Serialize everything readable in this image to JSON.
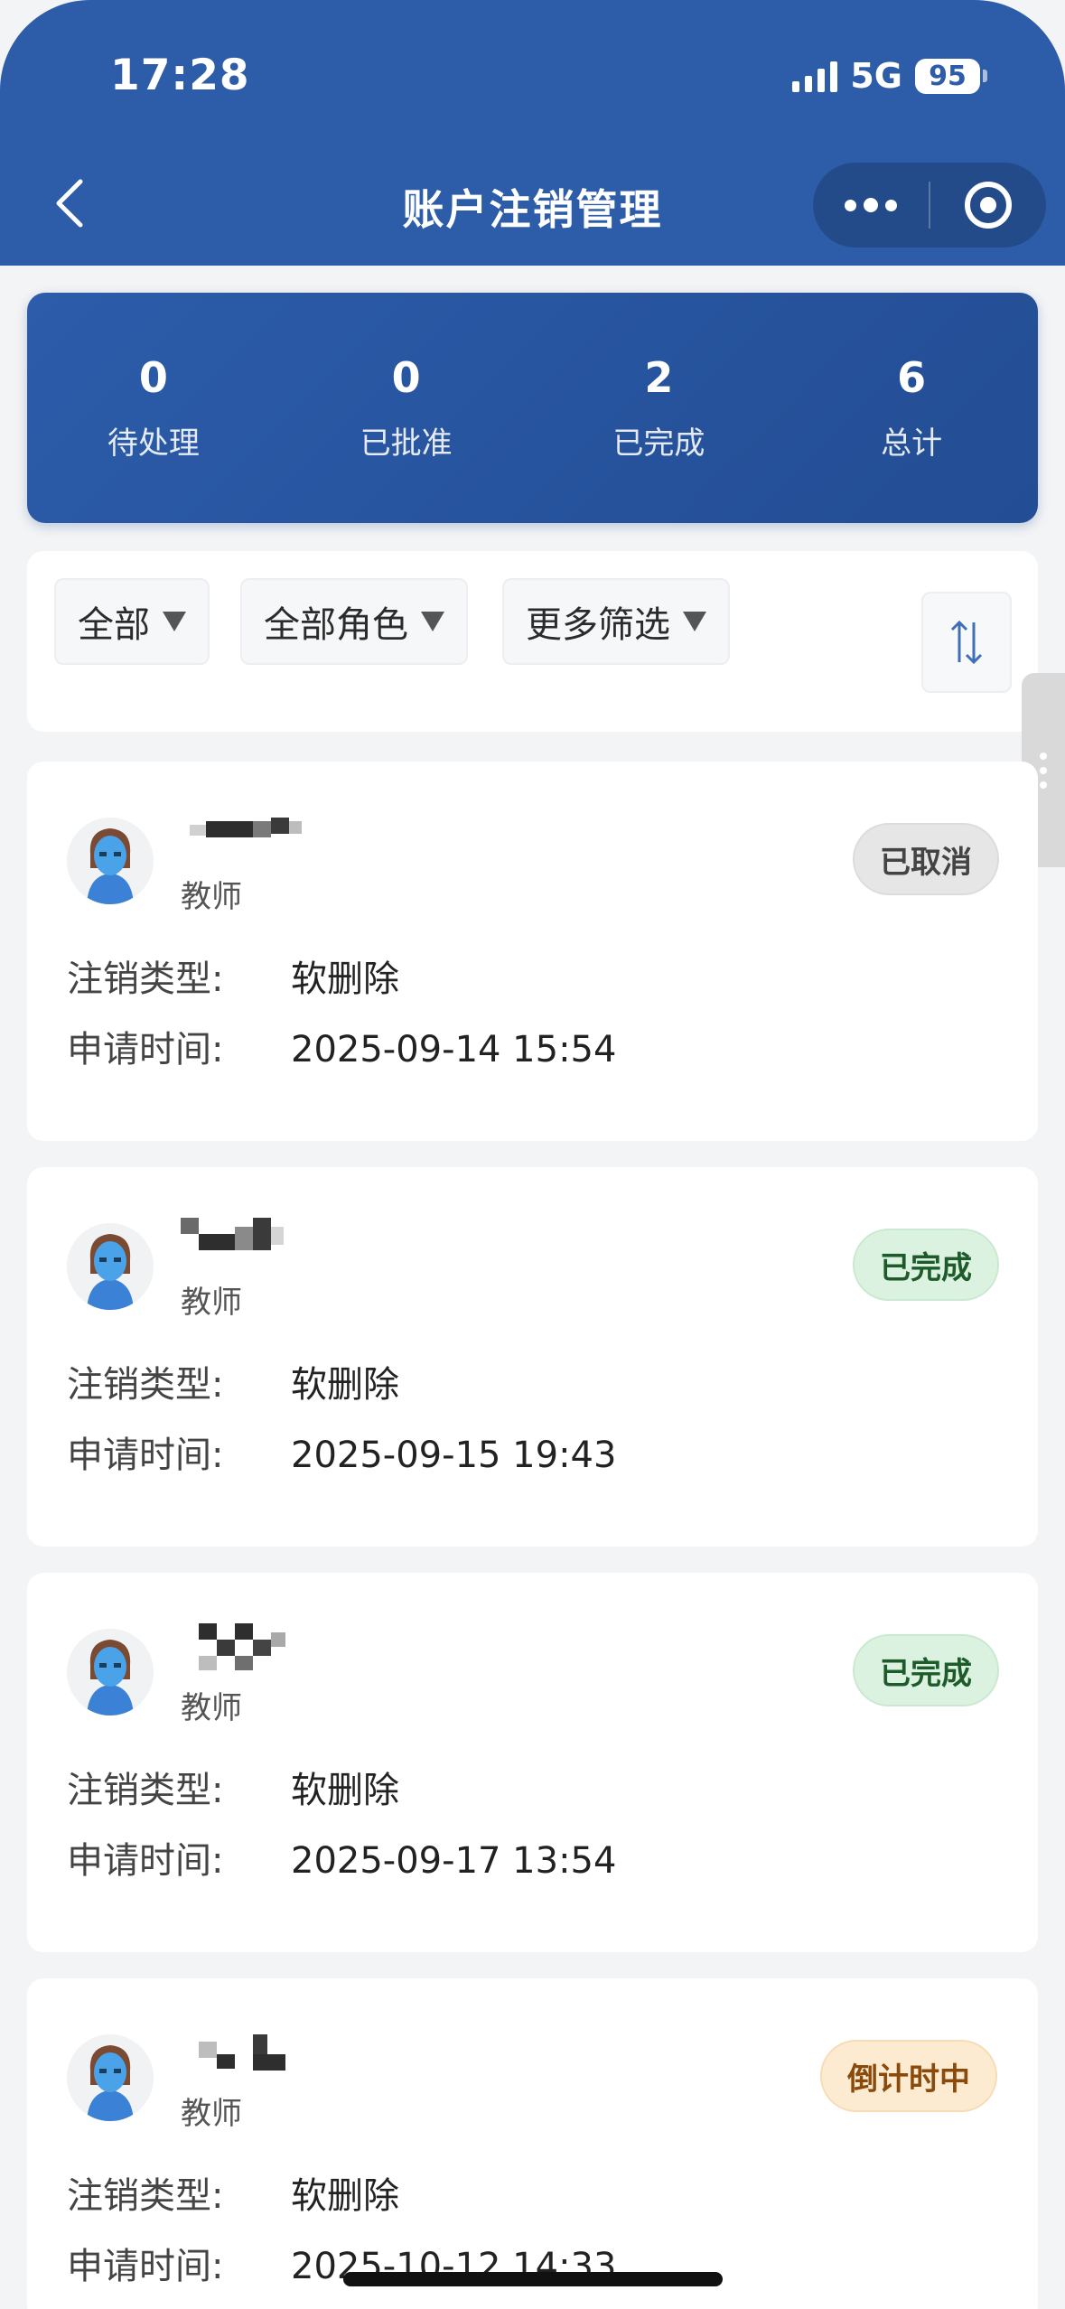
{
  "status_bar": {
    "time": "17:28",
    "network": "5G",
    "battery": "95"
  },
  "nav": {
    "title": "账户注销管理"
  },
  "stats": [
    {
      "value": "0",
      "label": "待处理"
    },
    {
      "value": "0",
      "label": "已批准"
    },
    {
      "value": "2",
      "label": "已完成"
    },
    {
      "value": "6",
      "label": "总计"
    }
  ],
  "filters": {
    "status": "全部",
    "role": "全部角色",
    "more": "更多筛选"
  },
  "labels": {
    "type": "注销类型:",
    "time": "申请时间:"
  },
  "records": [
    {
      "role": "教师",
      "status": "已取消",
      "type": "软删除",
      "time": "2025-09-14 15:54"
    },
    {
      "role": "教师",
      "status": "已完成",
      "type": "软删除",
      "time": "2025-09-15 19:43"
    },
    {
      "role": "教师",
      "status": "已完成",
      "type": "软删除",
      "time": "2025-09-17 13:54"
    },
    {
      "role": "教师",
      "status": "倒计时中",
      "type": "软删除",
      "time": "2025-10-12 14:33"
    }
  ],
  "colors": {
    "header": "#2d5ca8",
    "badge_done": "#dcf2e0",
    "badge_cancel": "#e6e6e6",
    "badge_countdown": "#fdebd1"
  },
  "icons": [
    "back-chevron-icon",
    "more-dots-icon",
    "close-target-icon",
    "sort-icon",
    "avatar-icon"
  ]
}
